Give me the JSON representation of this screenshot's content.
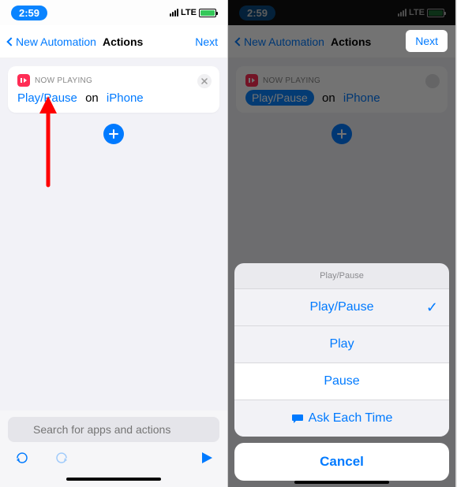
{
  "status": {
    "time": "2:59",
    "network": "LTE"
  },
  "nav": {
    "back_label": "New Automation",
    "title": "Actions",
    "next": "Next"
  },
  "card": {
    "header": "NOW PLAYING",
    "token_action": "Play/Pause",
    "token_on": "on",
    "token_device": "iPhone"
  },
  "search": {
    "placeholder": "Search for apps and actions"
  },
  "sheet": {
    "header": "Play/Pause",
    "options": {
      "play_pause": "Play/Pause",
      "play": "Play",
      "pause": "Pause",
      "ask": "Ask Each Time"
    },
    "cancel": "Cancel"
  }
}
